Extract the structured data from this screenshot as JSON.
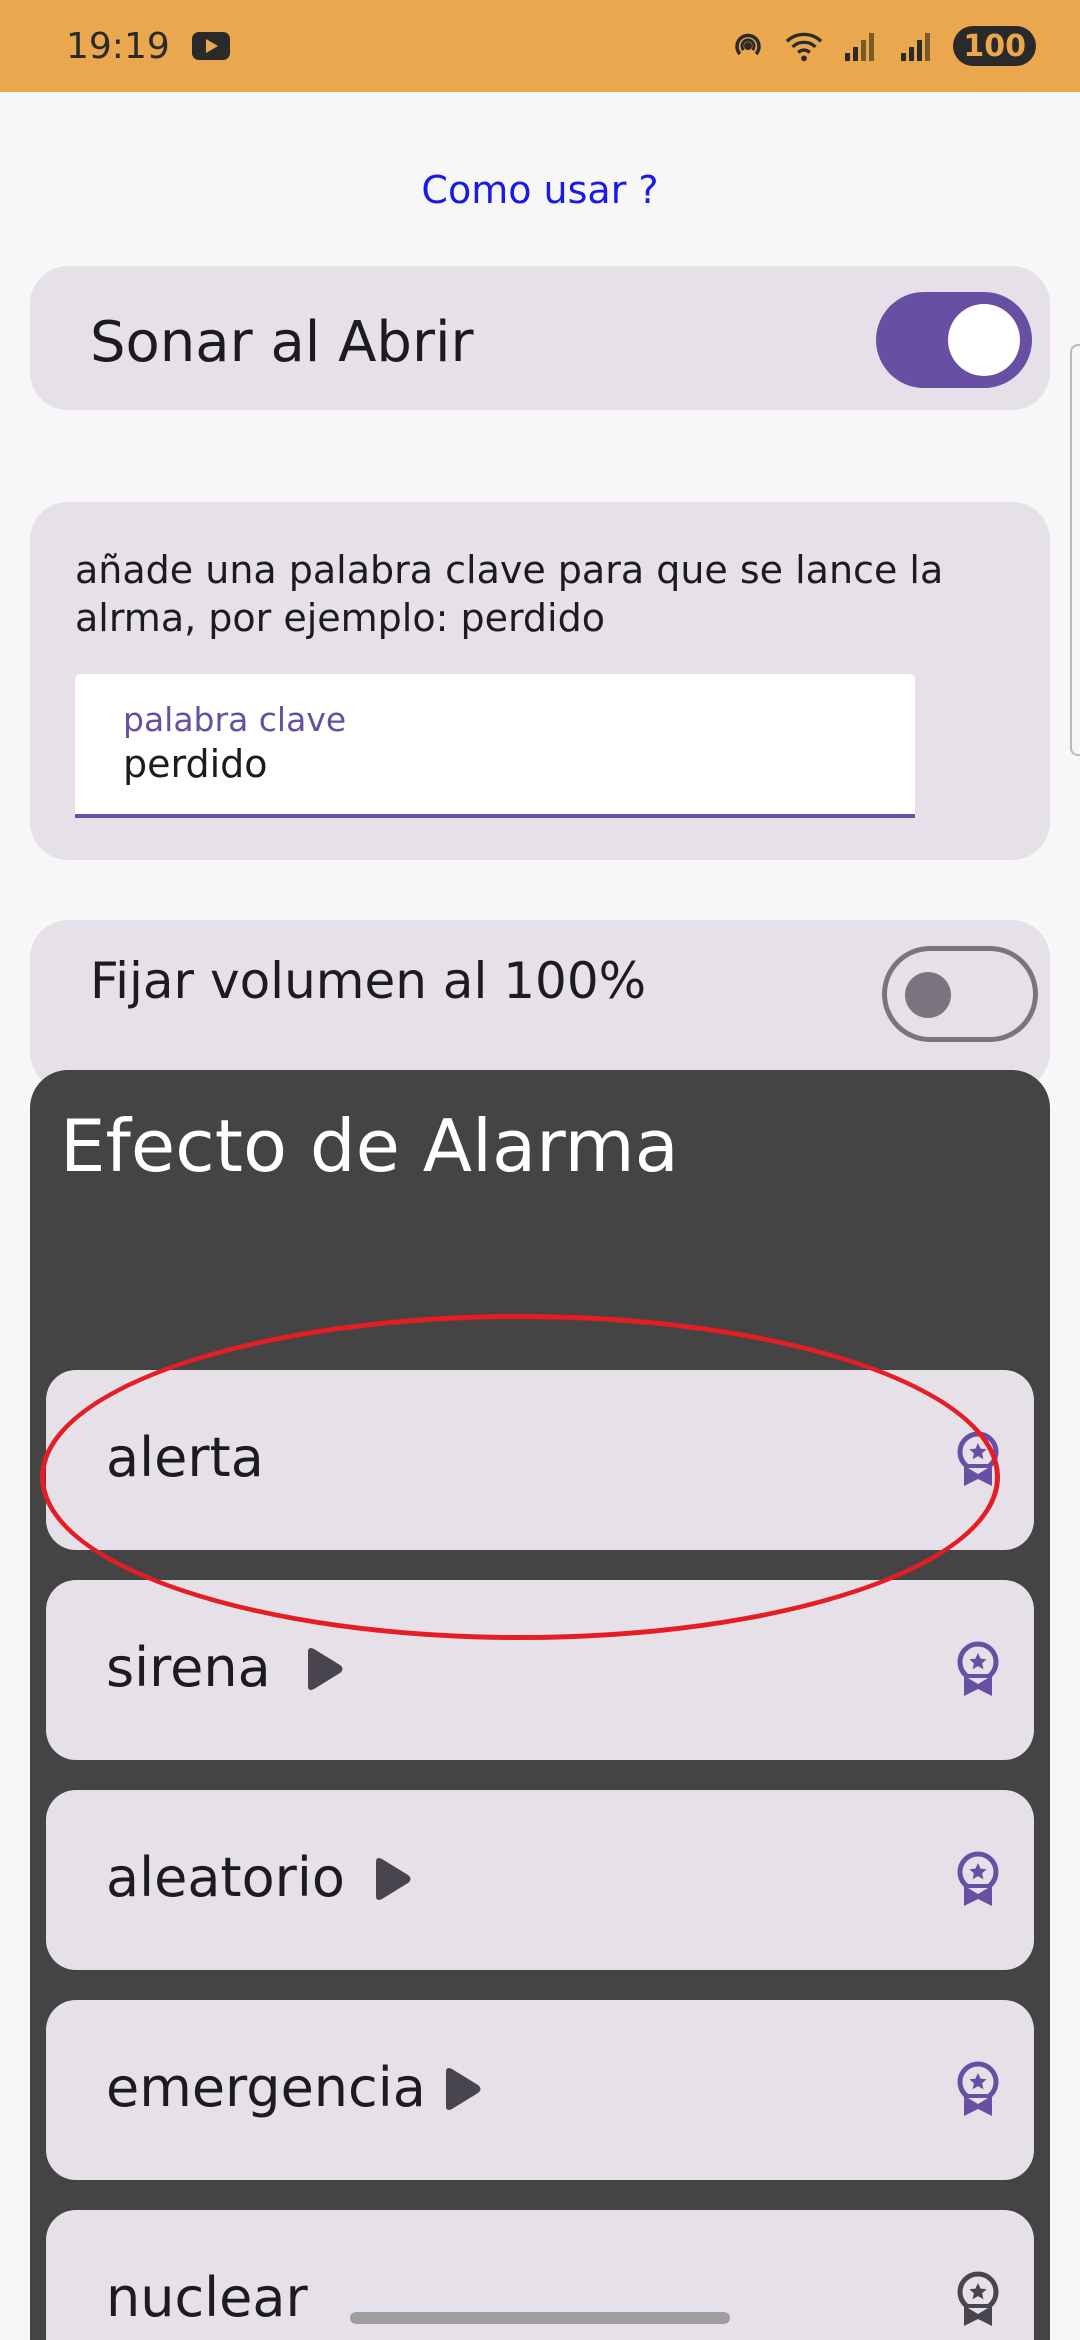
{
  "status_bar": {
    "time": "19:19",
    "battery": "100",
    "icons": [
      "youtube-icon",
      "hotspot-icon",
      "wifi-icon",
      "signal-icon",
      "signal-icon"
    ]
  },
  "help_link": "Como usar ?",
  "sonar": {
    "label": "Sonar al Abrir",
    "enabled": true
  },
  "keyword": {
    "description": "añade una palabra clave para que se lance la alrma, por ejemplo: perdido",
    "field_label": "palabra clave",
    "field_value": "perdido"
  },
  "volume": {
    "label": "Fijar volumen al 100%",
    "enabled": false
  },
  "alarm_effects": {
    "title": "Efecto de Alarma",
    "items": [
      {
        "label": "alerta",
        "has_play": false,
        "selected": true
      },
      {
        "label": "sirena",
        "has_play": true
      },
      {
        "label": "aleatorio",
        "has_play": true
      },
      {
        "label": "emergencia",
        "has_play": true
      },
      {
        "label": "nuclear",
        "has_play": false
      }
    ]
  },
  "colors": {
    "status_bar": "#eaa74d",
    "accent": "#6750a4",
    "card": "#e6e0e9",
    "panel": "#444444",
    "highlight": "#e61d25",
    "link": "#1a1ae6"
  }
}
